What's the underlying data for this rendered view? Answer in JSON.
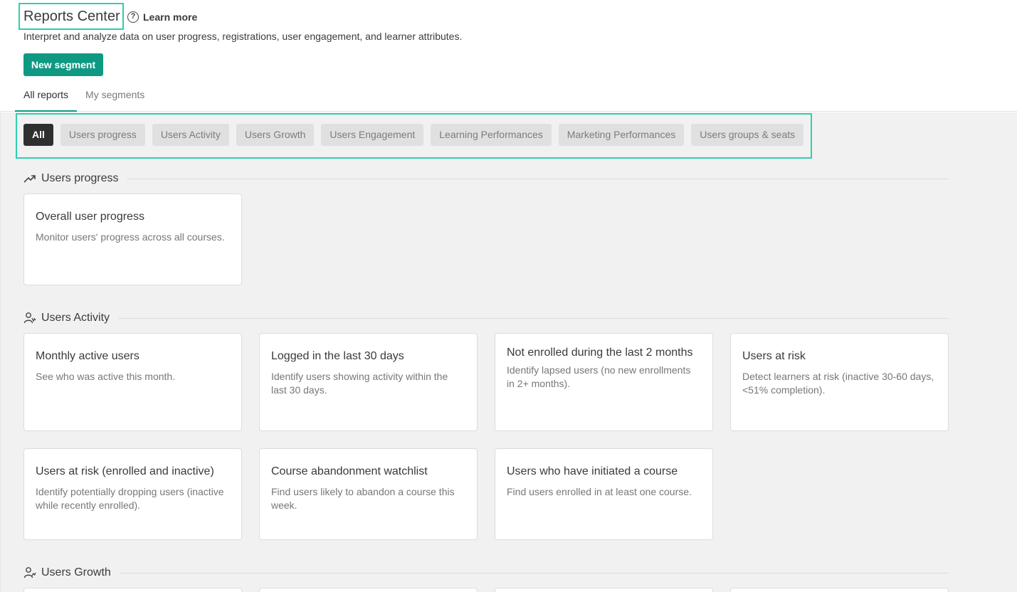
{
  "header": {
    "title": "Reports Center",
    "learn_more": "Learn more",
    "subtitle": "Interpret and analyze data on user progress, registrations, user engagement, and learner attributes.",
    "new_segment": "New segment",
    "tabs": [
      {
        "label": "All reports",
        "active": true
      },
      {
        "label": "My segments",
        "active": false
      }
    ]
  },
  "filters": [
    {
      "label": "All",
      "active": true
    },
    {
      "label": "Users progress",
      "active": false
    },
    {
      "label": "Users Activity",
      "active": false
    },
    {
      "label": "Users Growth",
      "active": false
    },
    {
      "label": "Users Engagement",
      "active": false
    },
    {
      "label": "Learning Performances",
      "active": false
    },
    {
      "label": "Marketing Performances",
      "active": false
    },
    {
      "label": "Users groups & seats",
      "active": false
    }
  ],
  "sections": {
    "progress": {
      "title": "Users progress",
      "icon": "trending-up-icon",
      "cards": [
        {
          "title": "Overall user progress",
          "desc": "Monitor users' progress across all courses."
        }
      ]
    },
    "activity": {
      "title": "Users Activity",
      "icon": "users-activity-icon",
      "cards": [
        {
          "title": "Monthly active users",
          "desc": "See who was active this month."
        },
        {
          "title": "Logged in the last 30 days",
          "desc": "Identify users showing activity within the last 30 days."
        },
        {
          "title": "Not enrolled during the last 2 months",
          "desc": "Identify lapsed users (no new enrollments in 2+ months)."
        },
        {
          "title": "Users at risk",
          "desc": "Detect learners at risk (inactive 30-60 days, <51% completion)."
        },
        {
          "title": "Users at risk (enrolled and inactive)",
          "desc": "Identify potentially dropping users (inactive while recently enrolled)."
        },
        {
          "title": "Course abandonment watchlist",
          "desc": "Find users likely to abandon a course this week."
        },
        {
          "title": "Users who have initiated a course",
          "desc": "Find users enrolled in at least one course."
        }
      ]
    },
    "growth": {
      "title": "Users Growth",
      "icon": "users-growth-icon"
    }
  }
}
